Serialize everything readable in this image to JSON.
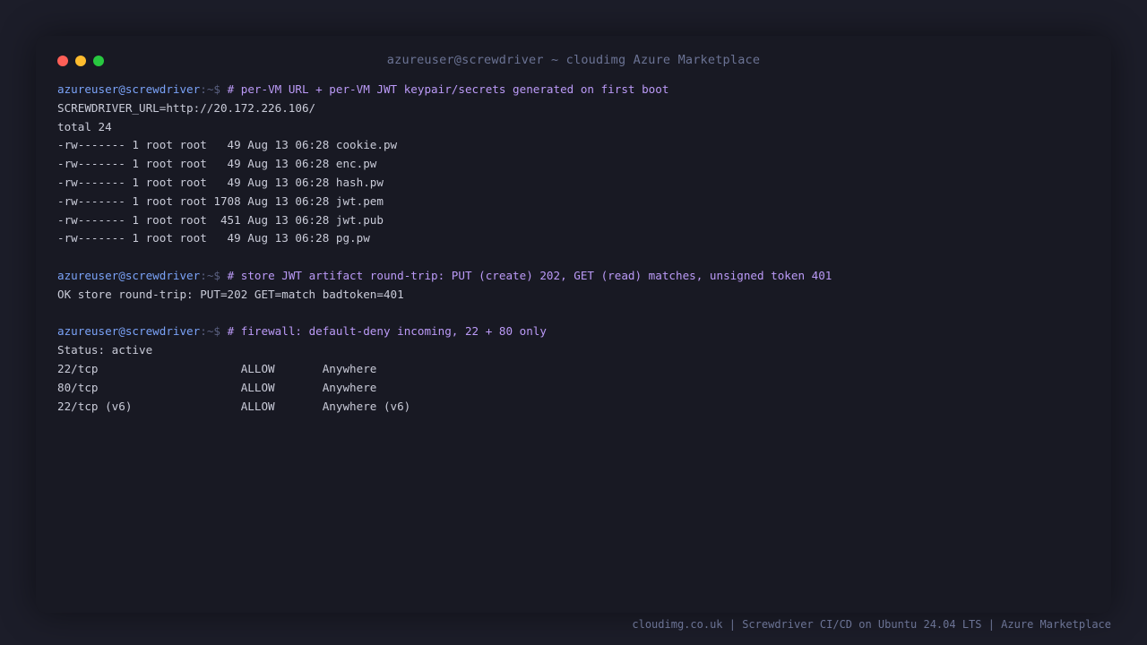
{
  "window": {
    "title": "azureuser@screwdriver ~ cloudimg Azure Marketplace",
    "traffic_lights": [
      {
        "name": "close-button",
        "color": "#ff5f57"
      },
      {
        "name": "minimize-button",
        "color": "#febc2e"
      },
      {
        "name": "maximize-button",
        "color": "#28c840"
      }
    ]
  },
  "colors": {
    "background": "#1c1d29",
    "window_bg": "#181923",
    "title_text": "#6b7394",
    "prompt_user": "#7aa2f7",
    "prompt_sep": "#5a6080",
    "command": "#bb9af7",
    "output": "#c9cbd8",
    "footer_text": "#6b7394"
  },
  "prompt": {
    "user": "azureuser@screwdriver",
    "sep": ":~$ "
  },
  "terminal": {
    "blocks": [
      {
        "command": "# per-VM URL + per-VM JWT keypair/secrets generated on first boot",
        "output": [
          "SCREWDRIVER_URL=http://20.172.226.106/",
          "total 24",
          "-rw------- 1 root root   49 Aug 13 06:28 cookie.pw",
          "-rw------- 1 root root   49 Aug 13 06:28 enc.pw",
          "-rw------- 1 root root   49 Aug 13 06:28 hash.pw",
          "-rw------- 1 root root 1708 Aug 13 06:28 jwt.pem",
          "-rw------- 1 root root  451 Aug 13 06:28 jwt.pub",
          "-rw------- 1 root root   49 Aug 13 06:28 pg.pw"
        ]
      },
      {
        "command": "# store JWT artifact round-trip: PUT (create) 202, GET (read) matches, unsigned token 401",
        "output": [
          "OK store round-trip: PUT=202 GET=match badtoken=401"
        ]
      },
      {
        "command": "# firewall: default-deny incoming, 22 + 80 only",
        "output": [
          "Status: active",
          "22/tcp                     ALLOW       Anywhere",
          "80/tcp                     ALLOW       Anywhere",
          "22/tcp (v6)                ALLOW       Anywhere (v6)"
        ]
      }
    ]
  },
  "footer": {
    "text": "cloudimg.co.uk | Screwdriver CI/CD on Ubuntu 24.04 LTS | Azure Marketplace"
  }
}
